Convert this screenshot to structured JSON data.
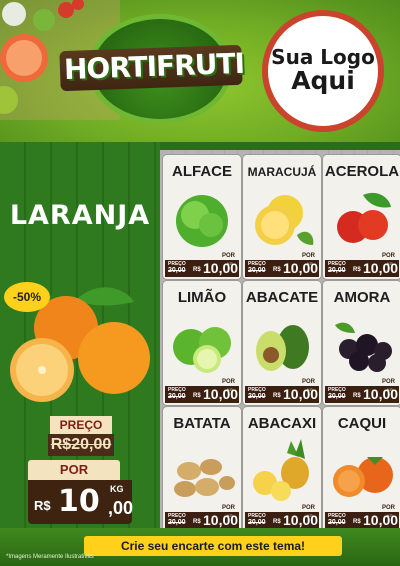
{
  "header": {
    "brand": "HORTIFRUTI",
    "logo_line1": "Sua Logo",
    "logo_line2": "Aqui"
  },
  "feature": {
    "title": "LARANJA",
    "discount": "-50%",
    "preco_label": "PREÇO",
    "preco_old": "R$20,00",
    "por_label": "POR",
    "currency": "R$",
    "price_int": "10",
    "price_cents": ",00",
    "unit": "KG"
  },
  "products": [
    {
      "name": "ALFACE",
      "art": "lettuce",
      "preco_label": "PREÇO",
      "old": "20,00",
      "por": "POR",
      "cur": "R$",
      "price": "10,00",
      "unit": "KG"
    },
    {
      "name": "MARACUJÁ",
      "art": "passion-fruit",
      "preco_label": "PREÇO",
      "old": "20,00",
      "por": "POR",
      "cur": "R$",
      "price": "10,00",
      "unit": "KG"
    },
    {
      "name": "ACEROLA",
      "art": "acerola",
      "preco_label": "PREÇO",
      "old": "20,00",
      "por": "POR",
      "cur": "R$",
      "price": "10,00",
      "unit": "KG"
    },
    {
      "name": "LIMÃO",
      "art": "lime",
      "preco_label": "PREÇO",
      "old": "20,00",
      "por": "POR",
      "cur": "R$",
      "price": "10,00",
      "unit": "KG"
    },
    {
      "name": "ABACATE",
      "art": "avocado",
      "preco_label": "PREÇO",
      "old": "20,00",
      "por": "POR",
      "cur": "R$",
      "price": "10,00",
      "unit": "KG"
    },
    {
      "name": "AMORA",
      "art": "blackberry",
      "preco_label": "PREÇO",
      "old": "20,00",
      "por": "POR",
      "cur": "R$",
      "price": "10,00",
      "unit": "KG"
    },
    {
      "name": "BATATA",
      "art": "potato",
      "preco_label": "PREÇO",
      "old": "20,00",
      "por": "POR",
      "cur": "R$",
      "price": "10,00",
      "unit": "KG"
    },
    {
      "name": "ABACAXI",
      "art": "pineapple",
      "preco_label": "PREÇO",
      "old": "20,00",
      "por": "POR",
      "cur": "R$",
      "price": "10,00",
      "unit": "KG"
    },
    {
      "name": "CAQUI",
      "art": "persimmon",
      "preco_label": "PREÇO",
      "old": "20,00",
      "por": "POR",
      "cur": "R$",
      "price": "10,00",
      "unit": "KG"
    }
  ],
  "footer": {
    "cta": "Crie seu encarte com este tema!",
    "disclaimer": "*Imagens Meramente Ilustrativas"
  },
  "colors": {
    "header_green": "#6fab24",
    "wood_green": "#2f7a1e",
    "price_brown": "#3b1f10",
    "tag_cream": "#f4e3bf",
    "accent_yellow": "#ffd11a",
    "logo_border": "#c9432d"
  }
}
